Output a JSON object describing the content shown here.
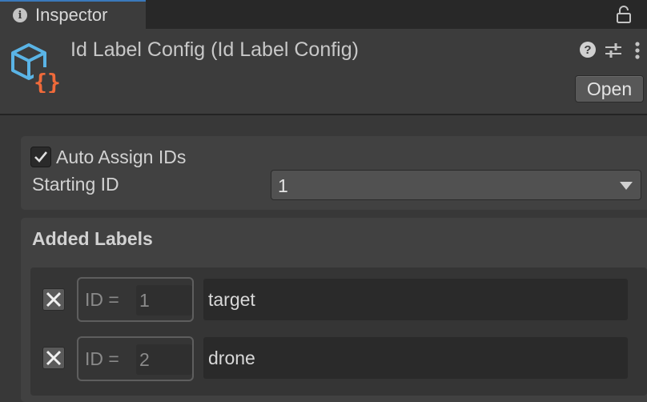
{
  "tab": {
    "label": "Inspector"
  },
  "header": {
    "title": "Id Label Config (Id Label Config)",
    "open_label": "Open",
    "help_glyph": "?"
  },
  "auto_assign": {
    "label": "Auto Assign IDs",
    "checked": true
  },
  "starting_id": {
    "label": "Starting ID",
    "value": "1"
  },
  "added_labels": {
    "title": "Added Labels",
    "id_prefix": "ID =",
    "rows": [
      {
        "id": "1",
        "name": "target"
      },
      {
        "id": "2",
        "name": "drone"
      }
    ]
  },
  "colors": {
    "accent": "#3a79bb",
    "asset_icon_blue": "#5ab4e6",
    "asset_icon_orange": "#f06a3a"
  },
  "icons": [
    "info-icon",
    "lock-icon",
    "script-asset-icon",
    "help-icon",
    "sliders-icon",
    "kebab-menu-icon",
    "checkmark-icon",
    "dropdown-arrow-icon",
    "remove-x-icon"
  ]
}
